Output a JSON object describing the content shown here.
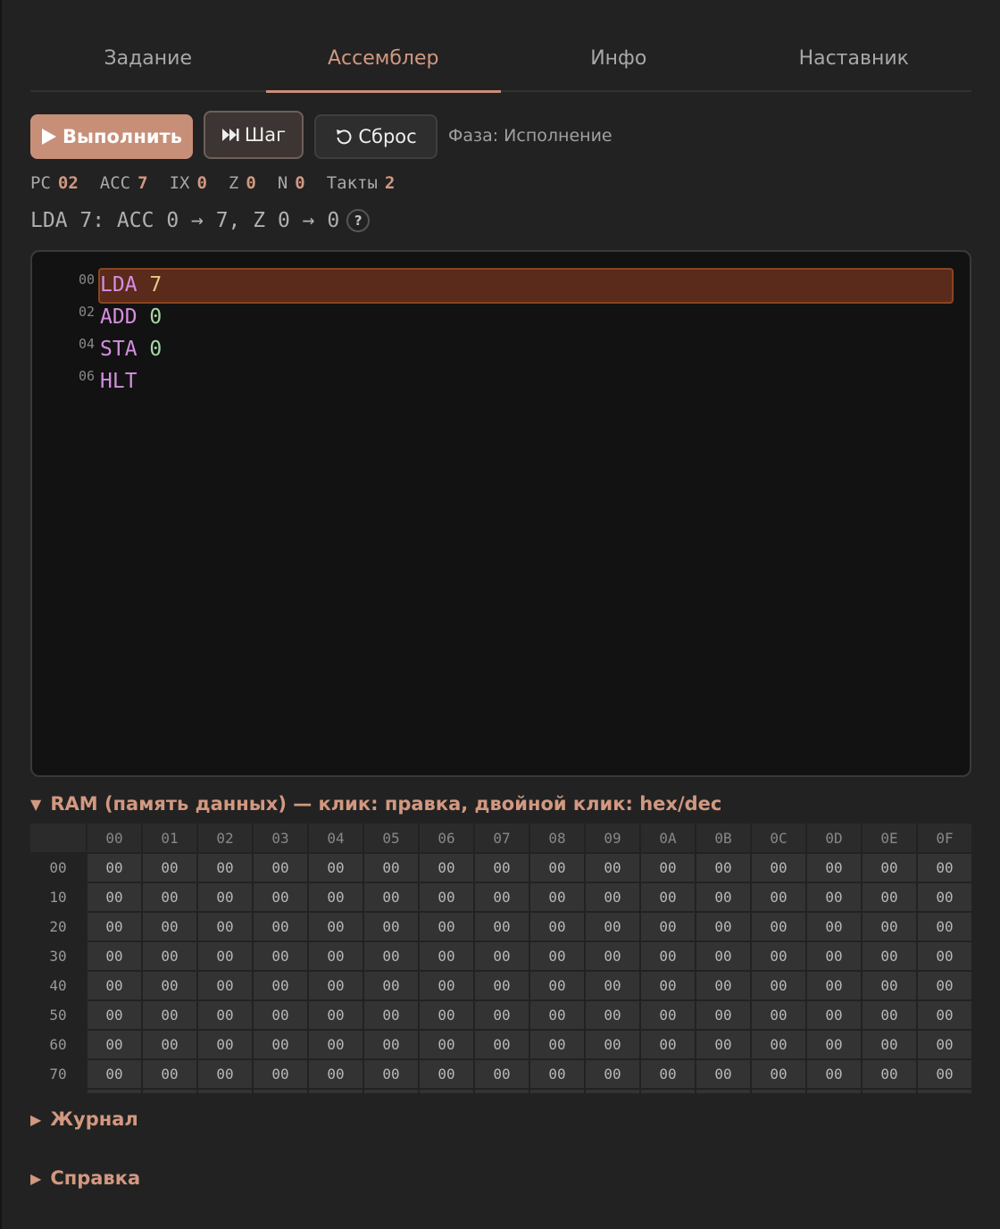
{
  "tabs": [
    {
      "label": "Задание",
      "active": false
    },
    {
      "label": "Ассемблер",
      "active": true
    },
    {
      "label": "Инфо",
      "active": false
    },
    {
      "label": "Наставник",
      "active": false
    }
  ],
  "toolbar": {
    "run_label": "Выполнить",
    "step_label": "Шаг",
    "reset_label": "Сброс",
    "phase": "Фаза: Исполнение"
  },
  "registers": [
    {
      "name": "PC",
      "value": "02"
    },
    {
      "name": "ACC",
      "value": "7"
    },
    {
      "name": "IX",
      "value": "0"
    },
    {
      "name": "Z",
      "value": "0"
    },
    {
      "name": "N",
      "value": "0"
    },
    {
      "name": "Такты",
      "value": "2"
    }
  ],
  "trace": {
    "text": "LDA 7: ACC 0 → 7, Z 0 → 0",
    "help": "?"
  },
  "program": [
    {
      "addr": "00",
      "op": "LDA",
      "arg": "7",
      "active": true
    },
    {
      "addr": "02",
      "op": "ADD",
      "arg": "0",
      "active": false
    },
    {
      "addr": "04",
      "op": "STA",
      "arg": "0",
      "active": false
    },
    {
      "addr": "06",
      "op": "HLT",
      "arg": "",
      "active": false
    }
  ],
  "ram": {
    "title": "RAM (память данных) — клик: правка, двойной клик: hex/dec",
    "columns": [
      "00",
      "01",
      "02",
      "03",
      "04",
      "05",
      "06",
      "07",
      "08",
      "09",
      "0A",
      "0B",
      "0C",
      "0D",
      "0E",
      "0F"
    ],
    "rows": [
      {
        "label": "00",
        "cells": [
          "00",
          "00",
          "00",
          "00",
          "00",
          "00",
          "00",
          "00",
          "00",
          "00",
          "00",
          "00",
          "00",
          "00",
          "00",
          "00"
        ]
      },
      {
        "label": "10",
        "cells": [
          "00",
          "00",
          "00",
          "00",
          "00",
          "00",
          "00",
          "00",
          "00",
          "00",
          "00",
          "00",
          "00",
          "00",
          "00",
          "00"
        ]
      },
      {
        "label": "20",
        "cells": [
          "00",
          "00",
          "00",
          "00",
          "00",
          "00",
          "00",
          "00",
          "00",
          "00",
          "00",
          "00",
          "00",
          "00",
          "00",
          "00"
        ]
      },
      {
        "label": "30",
        "cells": [
          "00",
          "00",
          "00",
          "00",
          "00",
          "00",
          "00",
          "00",
          "00",
          "00",
          "00",
          "00",
          "00",
          "00",
          "00",
          "00"
        ]
      },
      {
        "label": "40",
        "cells": [
          "00",
          "00",
          "00",
          "00",
          "00",
          "00",
          "00",
          "00",
          "00",
          "00",
          "00",
          "00",
          "00",
          "00",
          "00",
          "00"
        ]
      },
      {
        "label": "50",
        "cells": [
          "00",
          "00",
          "00",
          "00",
          "00",
          "00",
          "00",
          "00",
          "00",
          "00",
          "00",
          "00",
          "00",
          "00",
          "00",
          "00"
        ]
      },
      {
        "label": "60",
        "cells": [
          "00",
          "00",
          "00",
          "00",
          "00",
          "00",
          "00",
          "00",
          "00",
          "00",
          "00",
          "00",
          "00",
          "00",
          "00",
          "00"
        ]
      },
      {
        "label": "70",
        "cells": [
          "00",
          "00",
          "00",
          "00",
          "00",
          "00",
          "00",
          "00",
          "00",
          "00",
          "00",
          "00",
          "00",
          "00",
          "00",
          "00"
        ]
      }
    ]
  },
  "sections": {
    "log_label": "Журнал",
    "help_label": "Справка"
  },
  "colors": {
    "accent": "#c88f78",
    "highlight_line": "#5a2a1a",
    "opcode": "#d58ee0",
    "operand": "#a8d8a8"
  }
}
